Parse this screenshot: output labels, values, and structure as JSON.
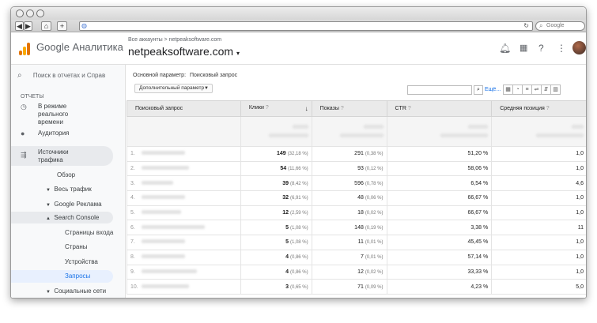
{
  "browser": {
    "search_placeholder": "Google"
  },
  "header": {
    "brand": "Google Аналитика",
    "breadcrumb": "Все аккаунты > netpeaksoftware.com",
    "account": "netpeaksoftware.com"
  },
  "sidebar": {
    "search_placeholder": "Поиск в отчетах и Справ",
    "section_label": "ОТЧЕТЫ",
    "realtime": "В режиме реального времени",
    "audience": "Аудитория",
    "acquisition": "Источники трафика",
    "overview": "Обзор",
    "all_traffic": "Весь трафик",
    "google_ads": "Google Реклама",
    "search_console": "Search Console",
    "landing_pages": "Страницы входа",
    "countries": "Страны",
    "devices": "Устройства",
    "queries": "Запросы",
    "social": "Социальные сети"
  },
  "main": {
    "primary_dimension_label": "Основной параметр:",
    "primary_dimension_value": "Поисковый запрос",
    "secondary_dropdown": "Дополнительный параметр",
    "more_link": "Ещё...",
    "columns": [
      "Поисковый запрос",
      "Клики",
      "Показы",
      "CTR",
      "Средняя позиция"
    ],
    "rows": [
      {
        "n": "1.",
        "clicks": "149",
        "clicks_pct": "(32,18 %)",
        "impr": "291",
        "impr_pct": "(0,38 %)",
        "ctr": "51,20 %",
        "pos": "1,0"
      },
      {
        "n": "2.",
        "clicks": "54",
        "clicks_pct": "(11,66 %)",
        "impr": "93",
        "impr_pct": "(0,12 %)",
        "ctr": "58,06 %",
        "pos": "1,0"
      },
      {
        "n": "3.",
        "clicks": "39",
        "clicks_pct": "(8,42 %)",
        "impr": "596",
        "impr_pct": "(0,78 %)",
        "ctr": "6,54 %",
        "pos": "4,6"
      },
      {
        "n": "4.",
        "clicks": "32",
        "clicks_pct": "(6,91 %)",
        "impr": "48",
        "impr_pct": "(0,06 %)",
        "ctr": "66,67 %",
        "pos": "1,0"
      },
      {
        "n": "5.",
        "clicks": "12",
        "clicks_pct": "(2,59 %)",
        "impr": "18",
        "impr_pct": "(0,02 %)",
        "ctr": "66,67 %",
        "pos": "1,0"
      },
      {
        "n": "6.",
        "clicks": "5",
        "clicks_pct": "(1,08 %)",
        "impr": "148",
        "impr_pct": "(0,19 %)",
        "ctr": "3,38 %",
        "pos": "11"
      },
      {
        "n": "7.",
        "clicks": "5",
        "clicks_pct": "(1,08 %)",
        "impr": "11",
        "impr_pct": "(0,01 %)",
        "ctr": "45,45 %",
        "pos": "1,0"
      },
      {
        "n": "8.",
        "clicks": "4",
        "clicks_pct": "(0,86 %)",
        "impr": "7",
        "impr_pct": "(0,01 %)",
        "ctr": "57,14 %",
        "pos": "1,0"
      },
      {
        "n": "9.",
        "clicks": "4",
        "clicks_pct": "(0,86 %)",
        "impr": "12",
        "impr_pct": "(0,02 %)",
        "ctr": "33,33 %",
        "pos": "1,0"
      },
      {
        "n": "10.",
        "clicks": "3",
        "clicks_pct": "(0,65 %)",
        "impr": "71",
        "impr_pct": "(0,09 %)",
        "ctr": "4,23 %",
        "pos": "5,0"
      }
    ]
  }
}
